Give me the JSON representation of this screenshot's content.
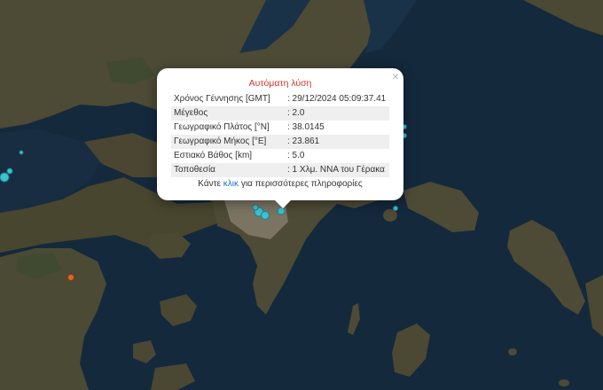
{
  "popup": {
    "title": "Αυτόματη λύση",
    "close_icon": "close-icon",
    "rows": [
      {
        "label": "Χρόνος Γέννησης [GMT]",
        "value": ": 29/12/2024 05:09:37.41"
      },
      {
        "label": "Μέγεθος",
        "value": ": 2.0"
      },
      {
        "label": "Γεωγραφικό Πλάτος [°N]",
        "value": ": 38.0145"
      },
      {
        "label": "Γεωγραφικό Μήκος [°E]",
        "value": ": 23.861"
      },
      {
        "label": "Εστιακό Βάθος [km]",
        "value": ": 5.0"
      },
      {
        "label": "Τοποθεσία",
        "value": ": 1 Χλμ. ΝΝΑ του Γέρακα"
      }
    ],
    "footer_prefix": "Κάντε",
    "footer_link": "κλικ",
    "footer_suffix": "για περισσότερες πληροφορίες"
  },
  "colors": {
    "sea": "#14293c",
    "land": "#4d4a35",
    "quake_cyan": "#3ec3cf",
    "quake_orange": "#e0642a",
    "title_red": "#d9322b",
    "link_blue": "#1a73c9"
  }
}
